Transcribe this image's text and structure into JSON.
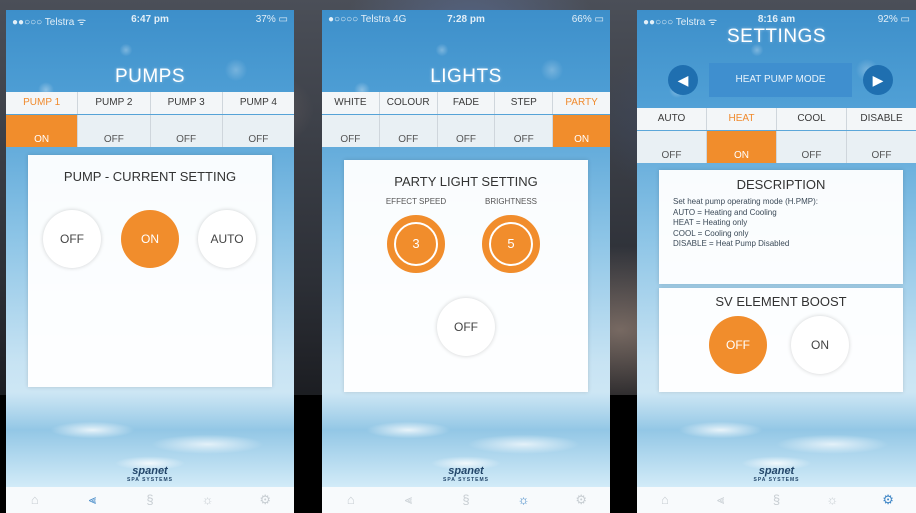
{
  "pumps": {
    "status": {
      "carrier": "●●○○○ Telstra ᯤ",
      "time": "6:47 pm",
      "battery": "37% ▭"
    },
    "title": "PUMPS",
    "tabs": [
      "PUMP 1",
      "PUMP 2",
      "PUMP 3",
      "PUMP 4"
    ],
    "states": [
      "ON",
      "OFF",
      "OFF",
      "OFF"
    ],
    "panel_title": "PUMP - CURRENT SETTING",
    "buttons": {
      "off": "OFF",
      "on": "ON",
      "auto": "AUTO"
    }
  },
  "lights": {
    "status": {
      "carrier": "●○○○○ Telstra 4G",
      "time": "7:28 pm",
      "battery": "66% ▭"
    },
    "title": "LIGHTS",
    "tabs": [
      "WHITE",
      "COLOUR",
      "FADE",
      "STEP",
      "PARTY"
    ],
    "states": [
      "OFF",
      "OFF",
      "OFF",
      "OFF",
      "ON"
    ],
    "panel_title": "PARTY LIGHT SETTING",
    "effect_speed_label": "EFFECT SPEED",
    "brightness_label": "BRIGHTNESS",
    "effect_speed_value": "3",
    "brightness_value": "5",
    "off_button": "OFF"
  },
  "settings": {
    "status": {
      "carrier": "●●○○○ Telstra ᯤ",
      "time": "8:16 am",
      "battery": "92% ▭"
    },
    "title": "SETTINGS",
    "mode_label": "HEAT PUMP MODE",
    "tabs": [
      "AUTO",
      "HEAT",
      "COOL",
      "DISABLE"
    ],
    "states": [
      "OFF",
      "ON",
      "OFF",
      "OFF"
    ],
    "description_title": "DESCRIPTION",
    "description_lines": [
      "Set heat pump operating mode (H.PMP):",
      "AUTO = Heating and Cooling",
      "HEAT = Heating only",
      "COOL = Cooling only",
      "DISABLE = Heat Pump Disabled"
    ],
    "boost_title": "SV ELEMENT BOOST",
    "boost_off": "OFF",
    "boost_on": "ON"
  },
  "brand": {
    "name": "spanet",
    "tagline": "SPA SYSTEMS"
  },
  "accent_color": "#f18d2c",
  "nav_active_color": "#3f86c6",
  "nav_icons": [
    "home-icon",
    "pump-icon",
    "blower-icon",
    "light-icon",
    "settings-gear-icon"
  ]
}
